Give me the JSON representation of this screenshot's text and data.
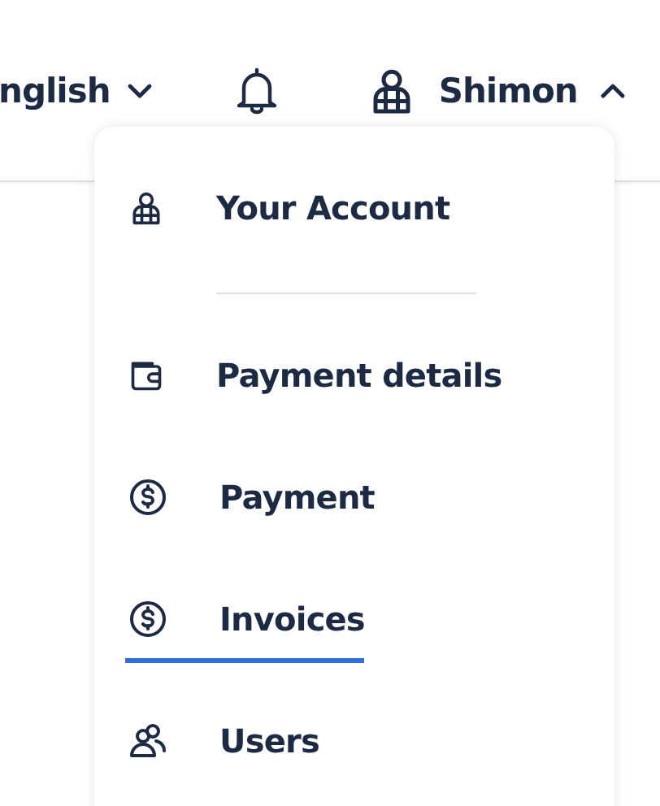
{
  "header": {
    "language": {
      "label": "nglish",
      "expanded": false
    },
    "user": {
      "name": "Shimon",
      "expanded": true
    }
  },
  "menu": {
    "items": [
      {
        "kind": "account",
        "label": "Your Account",
        "selected": false
      },
      {
        "kind": "divider"
      },
      {
        "kind": "wallet",
        "label": "Payment details",
        "selected": false
      },
      {
        "kind": "payment",
        "label": "Payment",
        "selected": false
      },
      {
        "kind": "payment",
        "label": "Invoices",
        "selected": true
      },
      {
        "kind": "users",
        "label": "Users",
        "selected": false
      }
    ]
  }
}
